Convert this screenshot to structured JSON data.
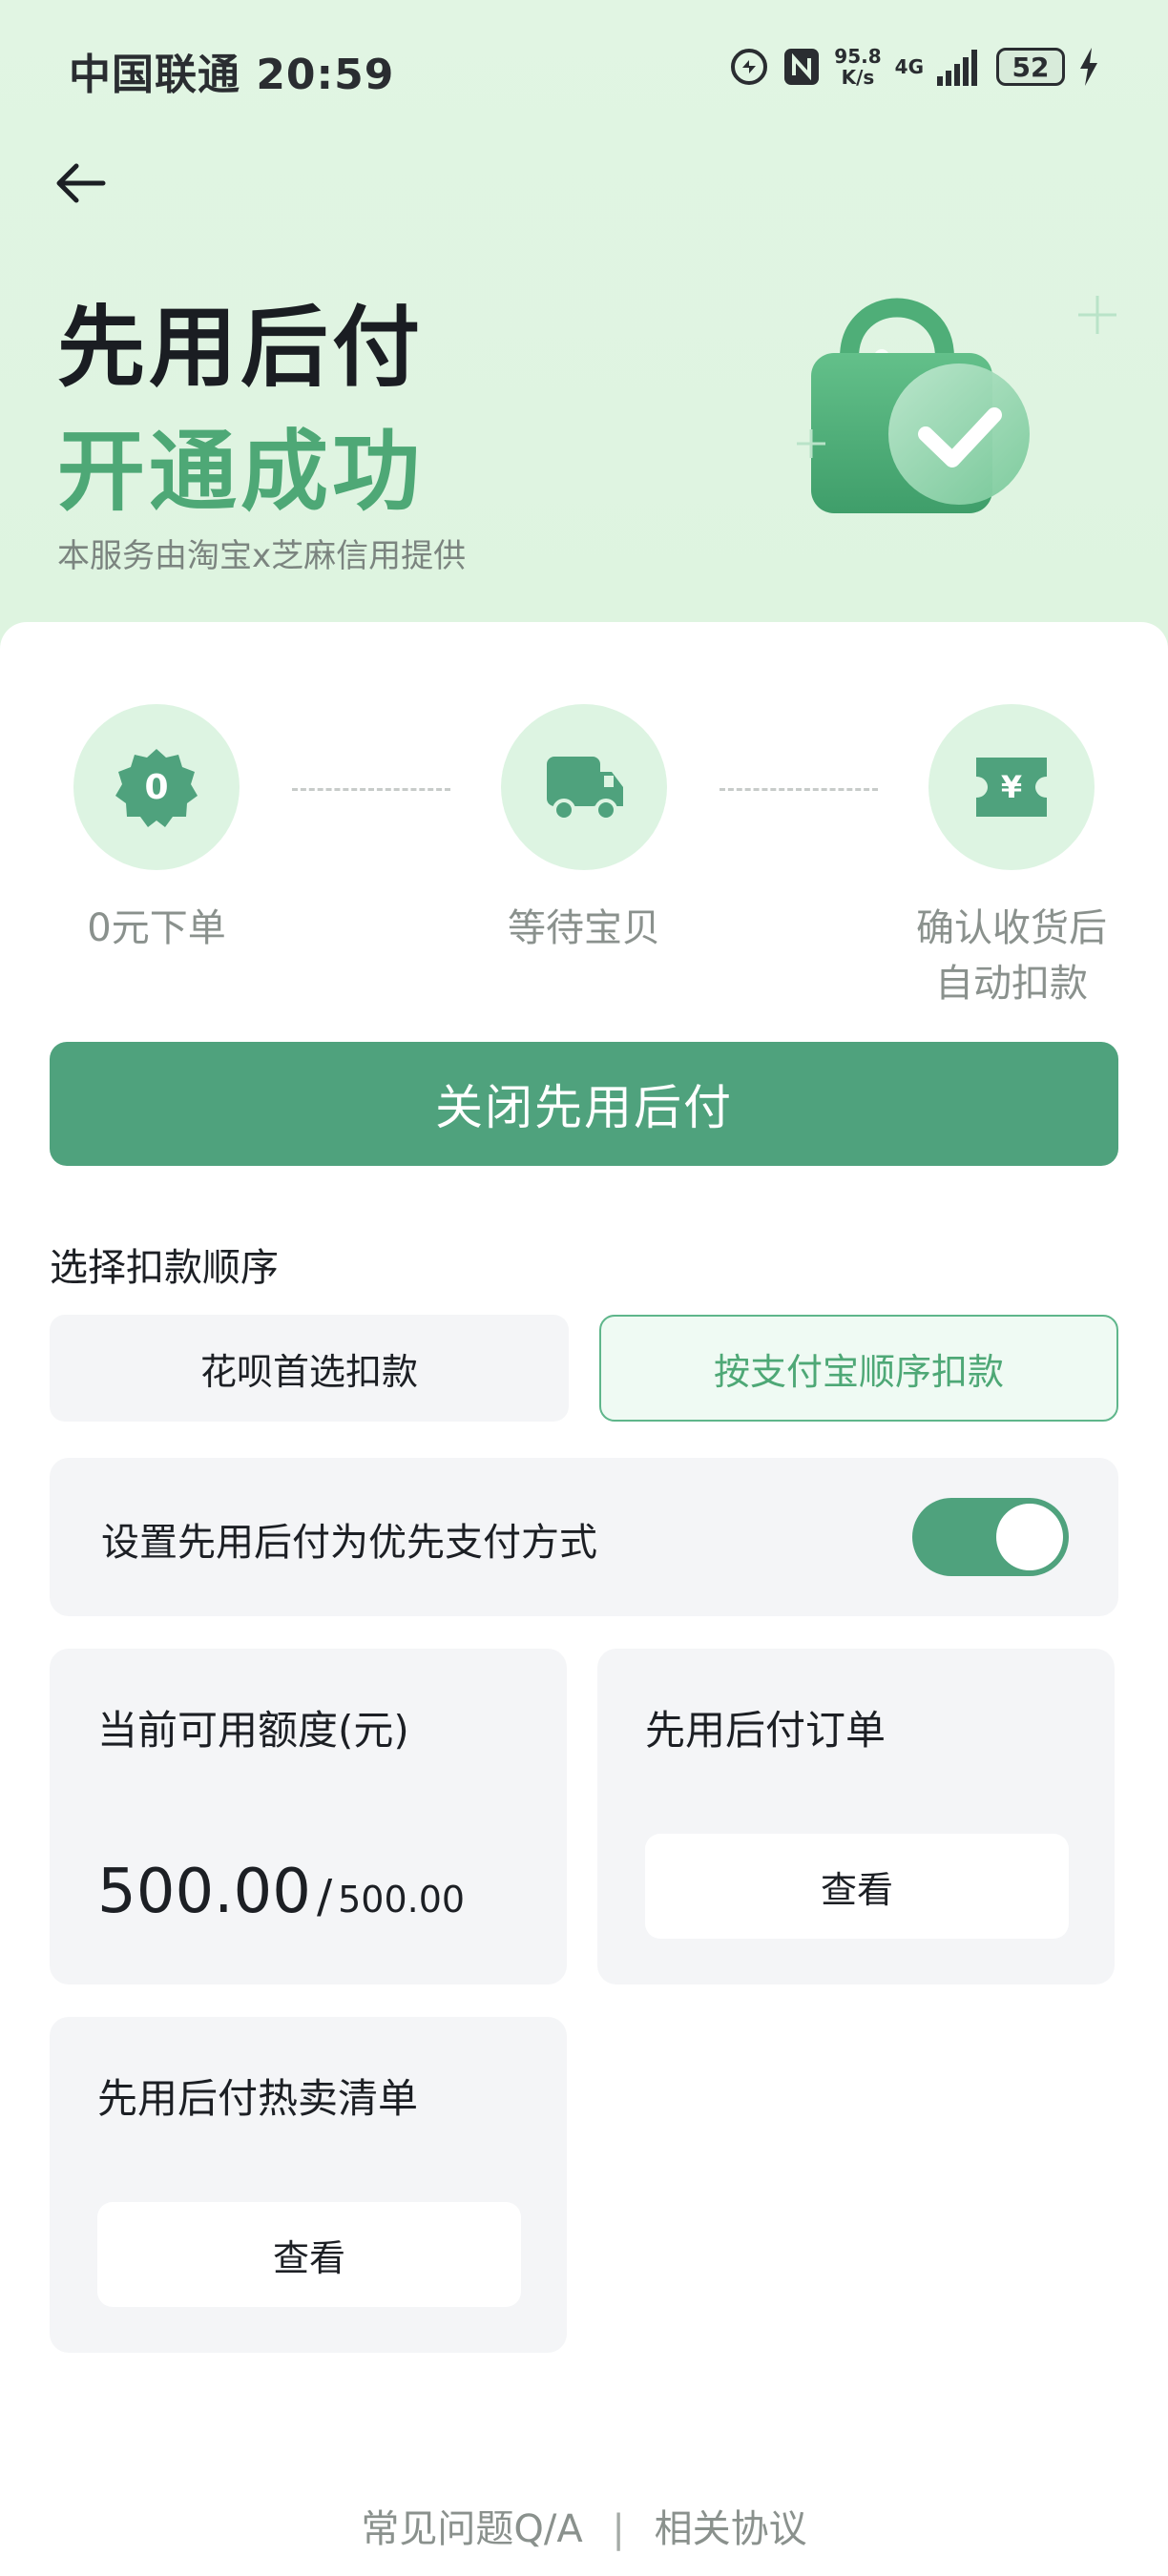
{
  "status_bar": {
    "carrier_time": "中国联通 20:59",
    "net_speed_value": "95.8",
    "net_speed_unit": "K/s",
    "network": "4G",
    "battery": "52"
  },
  "hero": {
    "title_line1": "先用后付",
    "title_line2": "开通成功",
    "subtitle": "本服务由淘宝x芝麻信用提供"
  },
  "steps": [
    {
      "label": "0元下单",
      "icon": "zero-badge-icon",
      "badge": "0"
    },
    {
      "label": "等待宝贝",
      "icon": "delivery-truck-icon"
    },
    {
      "label_line1": "确认收货后",
      "label_line2": "自动扣款",
      "icon": "yuan-ticket-icon",
      "badge": "¥"
    }
  ],
  "primary_action": {
    "label": "关闭先用后付"
  },
  "deduction_order": {
    "title": "选择扣款顺序",
    "options": [
      {
        "label": "花呗首选扣款",
        "selected": false
      },
      {
        "label": "按支付宝顺序扣款",
        "selected": true
      }
    ]
  },
  "preference": {
    "label": "设置先用后付为优先支付方式",
    "enabled": true
  },
  "quota": {
    "title": "当前可用额度(元)",
    "available": "500.00",
    "separator": "/",
    "total": "500.00"
  },
  "orders": {
    "title": "先用后付订单",
    "button": "查看"
  },
  "hot_list": {
    "title": "先用后付热卖清单",
    "button": "查看"
  },
  "footer": {
    "faq": "常见问题Q/A",
    "separator": "|",
    "agreement": "相关协议"
  },
  "colors": {
    "brand_green": "#4fa27d",
    "title_green": "#4ea876",
    "hero_bg": "#e1f5e3",
    "step_circle": "#ddf4e2"
  }
}
